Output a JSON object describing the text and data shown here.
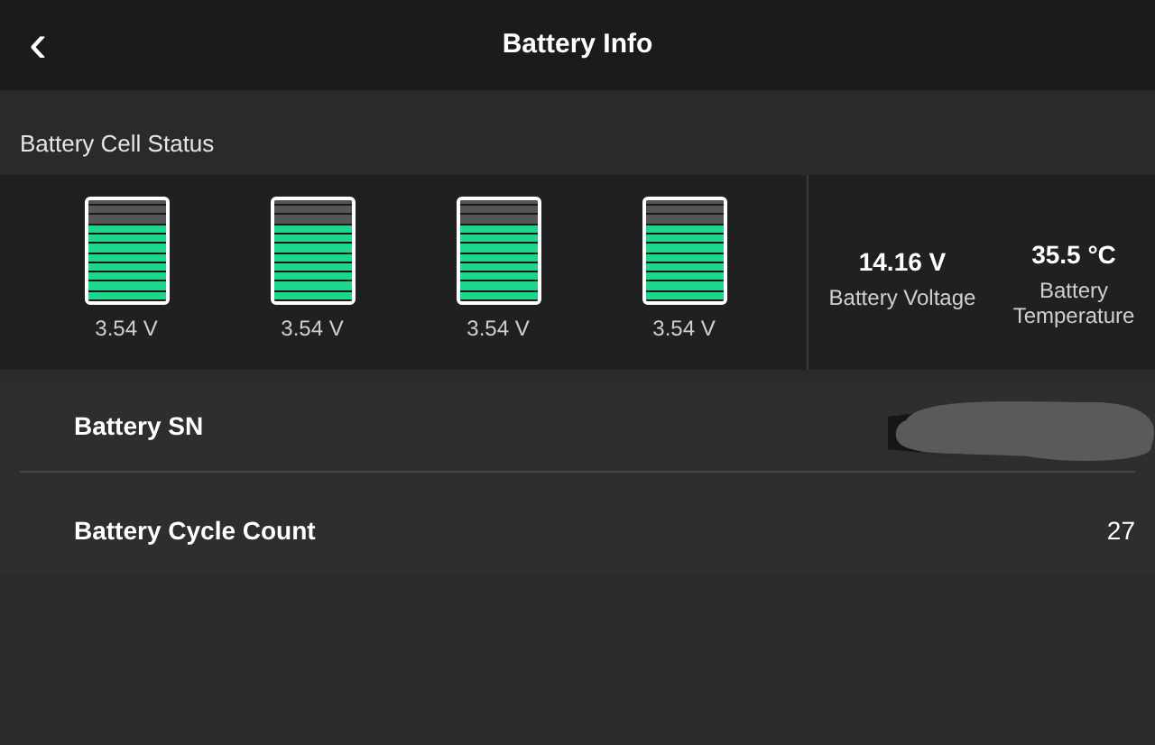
{
  "header": {
    "back_icon": "‹",
    "title": "Battery Info"
  },
  "section_title": "Battery Cell Status",
  "cells": [
    {
      "level": 0.73,
      "reading": "3.54 V"
    },
    {
      "level": 0.73,
      "reading": "3.54 V"
    },
    {
      "level": 0.73,
      "reading": "3.54 V"
    },
    {
      "level": 0.73,
      "reading": "3.54 V"
    }
  ],
  "stats": [
    {
      "value": "14.16 V",
      "label": "Battery Voltage"
    },
    {
      "value": "35.5 °C",
      "label": "Battery Temperature"
    }
  ],
  "rows": [
    {
      "label": "Battery SN",
      "kind": "redacted"
    },
    {
      "label": "Battery Cycle Count",
      "kind": "text",
      "value": "27"
    }
  ]
}
